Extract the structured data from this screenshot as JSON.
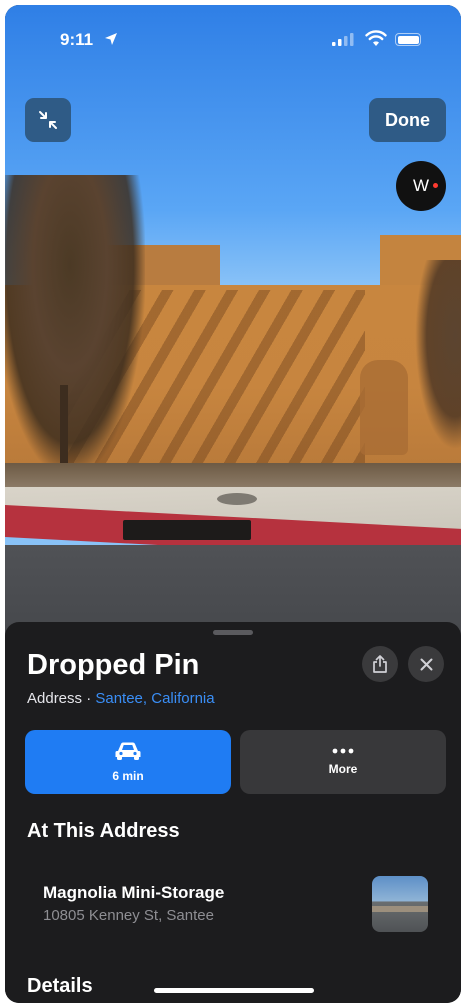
{
  "status_bar": {
    "time": "9:11"
  },
  "look_around": {
    "done_label": "Done",
    "compass_heading": "W"
  },
  "place": {
    "title": "Dropped Pin",
    "subtitle_prefix": "Address · ",
    "subtitle_link": "Santee, California"
  },
  "actions": {
    "drive_label": "6 min",
    "more_label": "More"
  },
  "at_address": {
    "heading": "At This Address",
    "items": [
      {
        "name": "Magnolia Mini-Storage",
        "address": "10805 Kenney St, Santee"
      }
    ]
  },
  "details": {
    "heading": "Details"
  },
  "colors": {
    "accent": "#1f7cf3",
    "link": "#3a8ef6",
    "sheet": "#1c1c1e",
    "overlay_button": "#2f5b86"
  }
}
